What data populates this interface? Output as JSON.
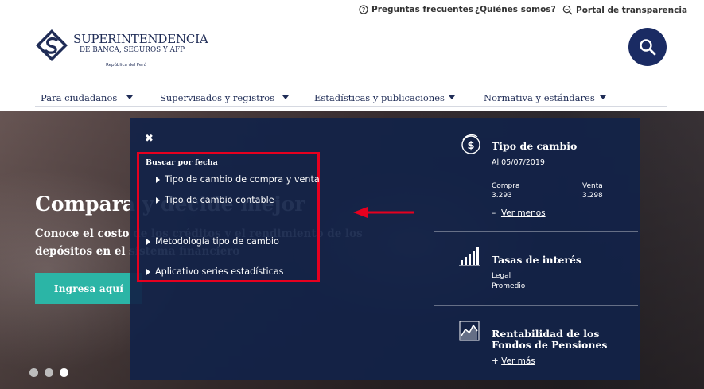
{
  "topbar": {
    "faq": "Preguntas frecuentes",
    "about": "¿Quiénes somos?",
    "transparency": "Portal de transparencia"
  },
  "logo": {
    "name": "SUPERINTENDENCIA",
    "sub": "DE BANCA, SEGUROS Y AFP",
    "country": "República del Perú"
  },
  "nav": {
    "items": [
      {
        "label": "Para ciudadanos"
      },
      {
        "label": "Supervisados y registros"
      },
      {
        "label": "Estadísticas y publicaciones"
      },
      {
        "label": "Normativa y estándares"
      }
    ]
  },
  "hero": {
    "title": "Compara y decide mejor",
    "text": "Conoce el costo de los créditos y el rendimiento de los depósitos en el sistema financiero",
    "button": "Ingresa aquí",
    "slides": 3,
    "active_slide": 3
  },
  "panel": {
    "close": "✖",
    "heading": "Buscar por fecha",
    "links": [
      {
        "label": "Tipo de cambio de compra y venta"
      },
      {
        "label": "Tipo de cambio contable"
      },
      {
        "label": "Metodología tipo de cambio"
      },
      {
        "label": "Aplicativo series estadísticas"
      }
    ],
    "highlight_color": "#e6001f"
  },
  "rates": {
    "exchange": {
      "title": "Tipo de cambio",
      "date": "Al 05/07/2019",
      "buy_label": "Compra",
      "buy_value": "3.293",
      "sell_label": "Venta",
      "sell_value": "3.298",
      "toggle": "Ver menos",
      "toggle_prefix": "–"
    },
    "interest": {
      "title": "Tasas de interés",
      "items": [
        "Legal",
        "Promedio"
      ]
    },
    "pension": {
      "title_line1": "Rentabilidad de los",
      "title_line2": "Fondos de Pensiones",
      "toggle": "Ver más",
      "toggle_prefix": "+"
    }
  },
  "colors": {
    "brand_navy": "#1a2b63",
    "accent_teal": "#2bb5a6",
    "panel_bg": "#122248"
  }
}
